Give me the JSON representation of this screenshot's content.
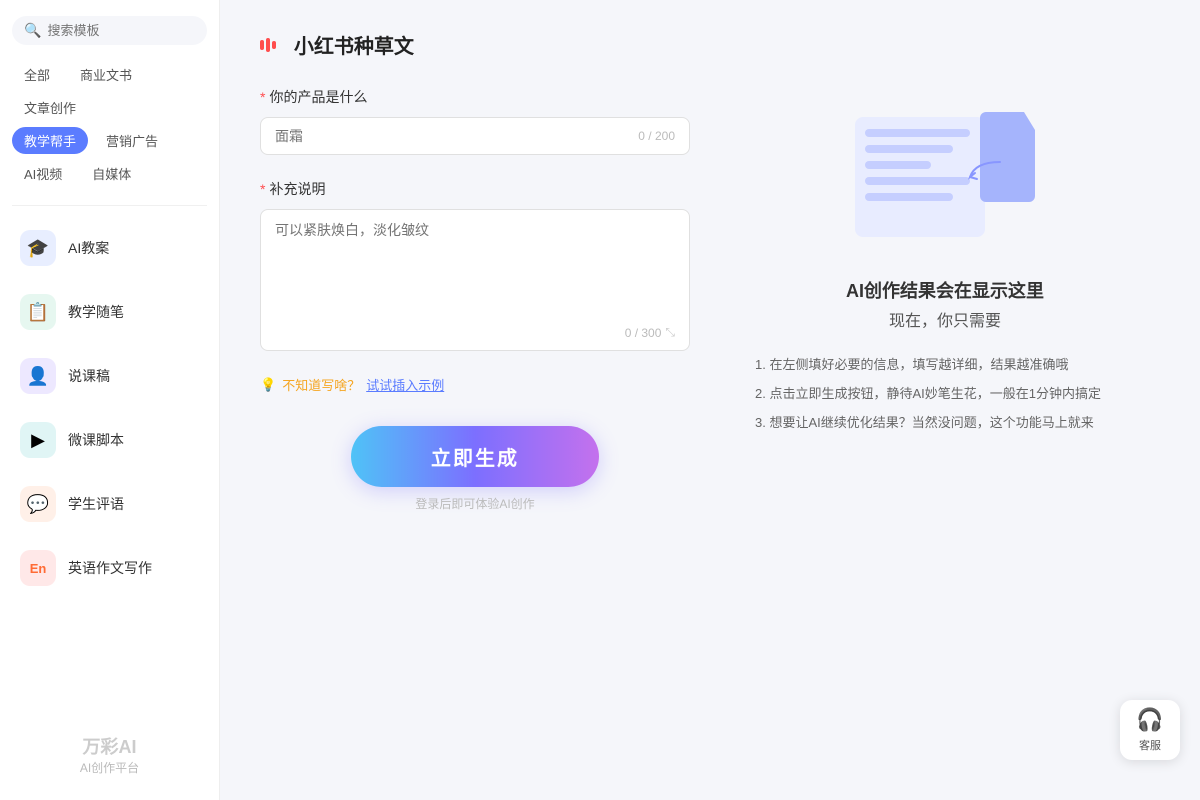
{
  "sidebar": {
    "search_placeholder": "搜索模板",
    "tags": [
      {
        "id": "all",
        "label": "全部",
        "active": false
      },
      {
        "id": "business",
        "label": "商业文书",
        "active": false
      },
      {
        "id": "article",
        "label": "文章创作",
        "active": false
      },
      {
        "id": "teaching",
        "label": "教学帮手",
        "active": true
      },
      {
        "id": "marketing",
        "label": "营销广告",
        "active": false
      },
      {
        "id": "ai-video",
        "label": "AI视频",
        "active": false
      },
      {
        "id": "self-media",
        "label": "自媒体",
        "active": false
      }
    ],
    "items": [
      {
        "id": "ai-lesson-plan",
        "label": "AI教案",
        "icon": "🎓",
        "color": "blue"
      },
      {
        "id": "teaching-notes",
        "label": "教学随笔",
        "icon": "📋",
        "color": "green"
      },
      {
        "id": "lecture-script",
        "label": "说课稿",
        "icon": "👤",
        "color": "purple"
      },
      {
        "id": "micro-lesson",
        "label": "微课脚本",
        "icon": "▶",
        "color": "teal"
      },
      {
        "id": "student-comment",
        "label": "学生评语",
        "icon": "💬",
        "color": "orange"
      },
      {
        "id": "english-writing",
        "label": "英语作文写作",
        "icon": "En",
        "color": "red"
      }
    ],
    "watermark": {
      "title": "万彩AI",
      "subtitle": "AI创作平台"
    }
  },
  "main": {
    "page_title": "小红书种草文",
    "field_product": {
      "label": "你的产品是什么",
      "placeholder": "面霜",
      "char_count": "0 / 200",
      "required": true
    },
    "field_supplement": {
      "label": "补充说明",
      "placeholder": "可以紧肤焕白，淡化皱纹",
      "char_count": "0 / 300",
      "required": true
    },
    "hint": {
      "icon": "💡",
      "text": "不知道写啥？试试插入示例"
    },
    "generate_btn": "立即生成",
    "generate_hint": "登录后即可体验AI创作",
    "right_panel": {
      "ai_result_label": "AI创作结果会在显示这里",
      "ai_sub_label": "现在，你只需要",
      "steps": [
        "1. 在左侧填好必要的信息，填写越详细，结果越准确哦",
        "2. 点击立即生成按钮，静待AI妙笔生花，一般在1分钟内搞定",
        "3. 想要让AI继续优化结果？当然没问题，这个功能马上就来"
      ]
    }
  },
  "customer_service": {
    "label": "客服",
    "icon": "headset"
  }
}
